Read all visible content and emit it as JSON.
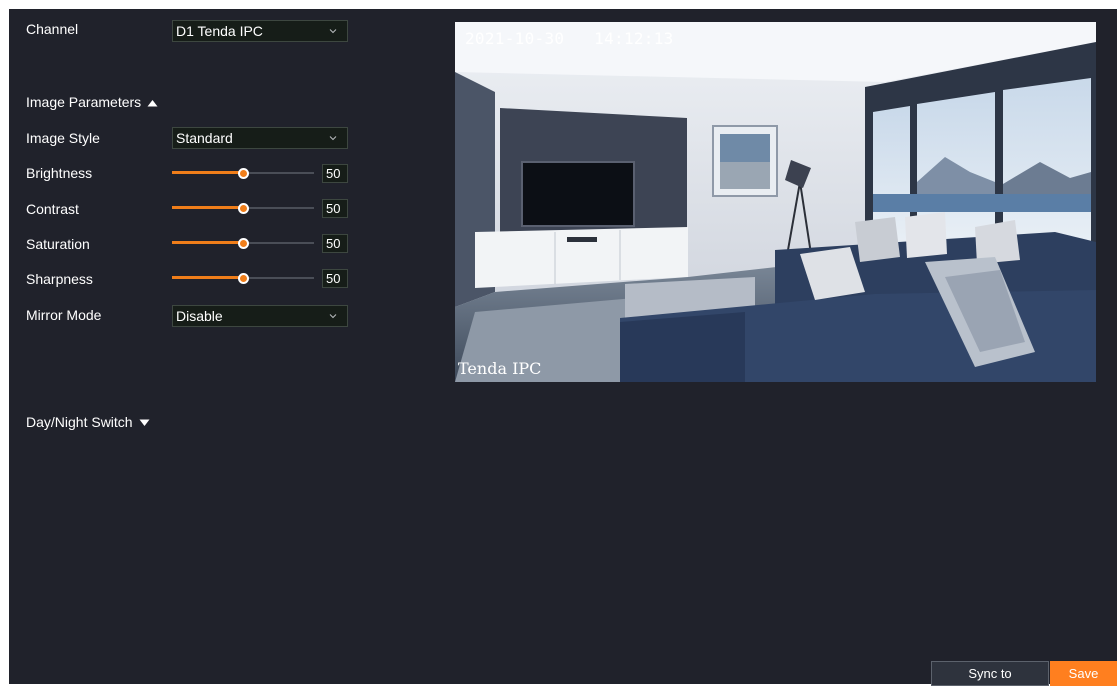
{
  "channel": {
    "label": "Channel",
    "value": "D1 Tenda IPC"
  },
  "image_parameters": {
    "title": "Image Parameters",
    "expanded": true,
    "image_style": {
      "label": "Image Style",
      "value": "Standard"
    },
    "sliders": [
      {
        "key": "brightness",
        "label": "Brightness",
        "value": "50",
        "percent": 50
      },
      {
        "key": "contrast",
        "label": "Contrast",
        "value": "50",
        "percent": 50
      },
      {
        "key": "saturation",
        "label": "Saturation",
        "value": "50",
        "percent": 50
      },
      {
        "key": "sharpness",
        "label": "Sharpness",
        "value": "50",
        "percent": 50
      }
    ],
    "mirror_mode": {
      "label": "Mirror Mode",
      "value": "Disable"
    }
  },
  "day_night": {
    "title": "Day/Night Switch",
    "expanded": false
  },
  "preview": {
    "date": "2021-10-30",
    "time": "14:12:13",
    "osd_name": "Tenda IPC"
  },
  "buttons": {
    "sync": "Sync to",
    "save": "Save"
  },
  "colors": {
    "accent": "#f07e1a",
    "background": "#20222b",
    "save": "#ff7f1f"
  },
  "icons": {
    "dropdown": "chevron-down-icon",
    "expanded": "triangle-up-icon",
    "collapsed": "triangle-down-icon"
  }
}
